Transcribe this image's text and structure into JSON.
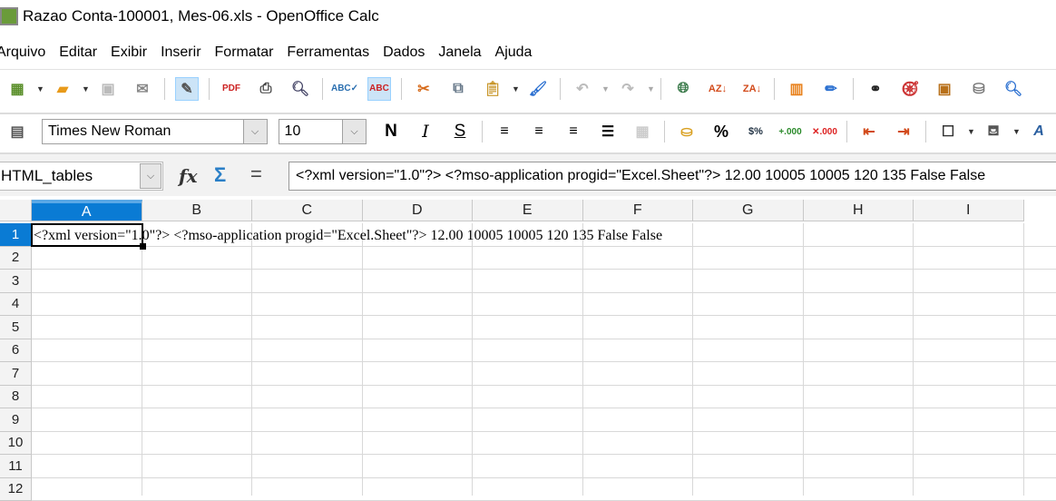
{
  "window": {
    "title": "Razao Conta-100001, Mes-06.xls - OpenOffice Calc"
  },
  "menu": [
    "Arquivo",
    "Editar",
    "Exibir",
    "Inserir",
    "Formatar",
    "Ferramentas",
    "Dados",
    "Janela",
    "Ajuda"
  ],
  "toolbar2": {
    "font_name": "Times New Roman",
    "font_size": "10",
    "bold": "N",
    "italic": "I",
    "underline": "S",
    "percent": "%"
  },
  "formula_bar": {
    "name_box": "HTML_tables",
    "formula": "<?xml version=\"1.0\"?> <?mso-application progid=\"Excel.Sheet\"?> 12.00 10005 10005 120 135 False False",
    "fx": "fx",
    "sigma": "Σ",
    "equals": "="
  },
  "sheet": {
    "columns": [
      "A",
      "B",
      "C",
      "D",
      "E",
      "F",
      "G",
      "H",
      "I"
    ],
    "rows": [
      "1",
      "2",
      "3",
      "4",
      "5",
      "6",
      "7",
      "8",
      "9",
      "10",
      "11",
      "12"
    ],
    "active_cell": "A1",
    "cell_A1": "<?xml version=\"1.0\"?> <?mso-application progid=\"Excel.Sheet\"?> 12.00 10005 10005 120 135 False False"
  }
}
